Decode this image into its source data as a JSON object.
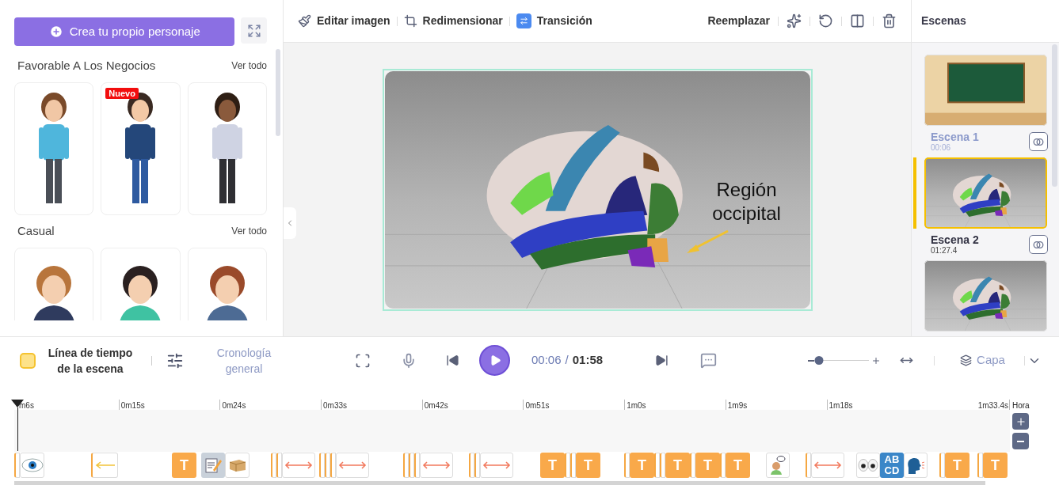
{
  "left_panel": {
    "create_button": "Crea tu propio personaje",
    "sections": [
      {
        "title": "Favorable A Los Negocios",
        "link": "Ver todo",
        "characters": [
          {
            "kind": "standing"
          },
          {
            "kind": "standing",
            "badge": "Nuevo"
          },
          {
            "kind": "standing"
          }
        ]
      },
      {
        "title": "Casual",
        "link": "Ver todo",
        "characters": [
          {
            "kind": "bust"
          },
          {
            "kind": "bust"
          },
          {
            "kind": "bust"
          }
        ]
      }
    ]
  },
  "toolbar": {
    "left": [
      {
        "kind": "brush",
        "label": "Editar imagen"
      },
      {
        "kind": "crop",
        "label": "Redimensionar"
      },
      {
        "kind": "transition",
        "label": "Transición"
      }
    ],
    "replace": "Reemplazar"
  },
  "canvas": {
    "caption": "Región occipital"
  },
  "scenes_panel": {
    "title": "Escenas",
    "scenes": [
      {
        "kind": "board",
        "title": "Escena 1",
        "time": "00:06",
        "selected": false
      },
      {
        "kind": "brain",
        "title": "Escena 2",
        "time": "01:27.4",
        "selected": true
      },
      {
        "kind": "brain",
        "selected": false
      }
    ]
  },
  "controls": {
    "tabs": [
      {
        "kind": "scene",
        "label": "Línea de tiempo de la escena",
        "selected": true
      },
      {
        "kind": "general",
        "label": "Cronología general",
        "selected": false
      }
    ],
    "time": {
      "current": "00:06",
      "separator": "/",
      "total": "01:58"
    },
    "zoom": {
      "level": 0.05
    },
    "layer": "Capa"
  },
  "timeline": {
    "ruler": [
      "m6s",
      "0m15s",
      "0m24s",
      "0m33s",
      "0m42s",
      "0m51s",
      "1m0s",
      "1m9s",
      "1m18s",
      "1m33.4s"
    ],
    "hora": "Hora",
    "groups": [
      [
        {
          "kind": "stub"
        },
        {
          "kind": "eye"
        }
      ],
      [
        {
          "kind": "arrow"
        }
      ],
      [
        {
          "kind": "text",
          "label": "T"
        }
      ],
      [
        {
          "kind": "pencil"
        },
        {
          "kind": "box"
        }
      ],
      [
        {
          "kind": "stub"
        },
        {
          "kind": "stub"
        },
        {
          "kind": "double-arrow"
        }
      ],
      [
        {
          "kind": "stub"
        },
        {
          "kind": "stub"
        },
        {
          "kind": "stub"
        },
        {
          "kind": "double-arrow"
        }
      ],
      [
        {
          "kind": "stub"
        },
        {
          "kind": "stub"
        },
        {
          "kind": "stub"
        },
        {
          "kind": "double-arrow"
        }
      ],
      [
        {
          "kind": "stub"
        },
        {
          "kind": "stub"
        },
        {
          "kind": "double-arrow"
        }
      ],
      [
        {
          "kind": "text",
          "label": "T"
        },
        {
          "kind": "stub"
        },
        {
          "kind": "stub"
        },
        {
          "kind": "text",
          "label": "T"
        }
      ],
      [
        {
          "kind": "stub"
        },
        {
          "kind": "text",
          "label": "T"
        },
        {
          "kind": "stub"
        },
        {
          "kind": "stub"
        },
        {
          "kind": "text",
          "label": "T"
        },
        {
          "kind": "stub"
        },
        {
          "kind": "text",
          "label": "T"
        },
        {
          "kind": "stub"
        },
        {
          "kind": "text",
          "label": "T"
        }
      ],
      [
        {
          "kind": "person"
        }
      ],
      [
        {
          "kind": "stub"
        },
        {
          "kind": "double-arrow"
        }
      ],
      [
        {
          "kind": "eyes"
        },
        {
          "kind": "letters",
          "label": "ABCD"
        },
        {
          "kind": "speaker"
        }
      ],
      [
        {
          "kind": "stub"
        },
        {
          "kind": "text",
          "label": "T"
        }
      ],
      [
        {
          "kind": "stub"
        },
        {
          "kind": "text",
          "label": "T"
        }
      ]
    ]
  }
}
